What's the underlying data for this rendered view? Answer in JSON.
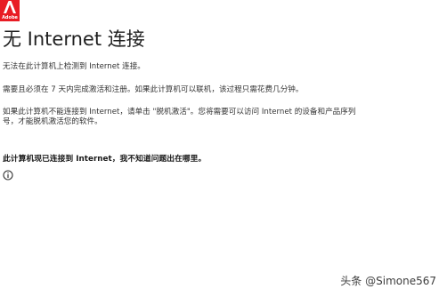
{
  "logo": {
    "text": "Adobe",
    "color": "#e81c24"
  },
  "title": "无 Internet 连接",
  "paragraphs": {
    "p1": "无法在此计算机上检测到 Internet 连接。",
    "p2": "需要且必须在 7 天内完成激活和注册。如果此计算机可以联机，该过程只需花费几分钟。",
    "p3_line1": "如果此计算机不能连接到 Internet，请单击 \"脱机激活\"。您将需要可以访问 Internet 的设备和产品序列",
    "p3_line2": "号，才能脱机激活您的软件。"
  },
  "status_link": "此计算机现已连接到 Internet，我不知道问题出在哪里。",
  "icons": {
    "info": "info-icon"
  },
  "watermark": "头条 @Simone567"
}
